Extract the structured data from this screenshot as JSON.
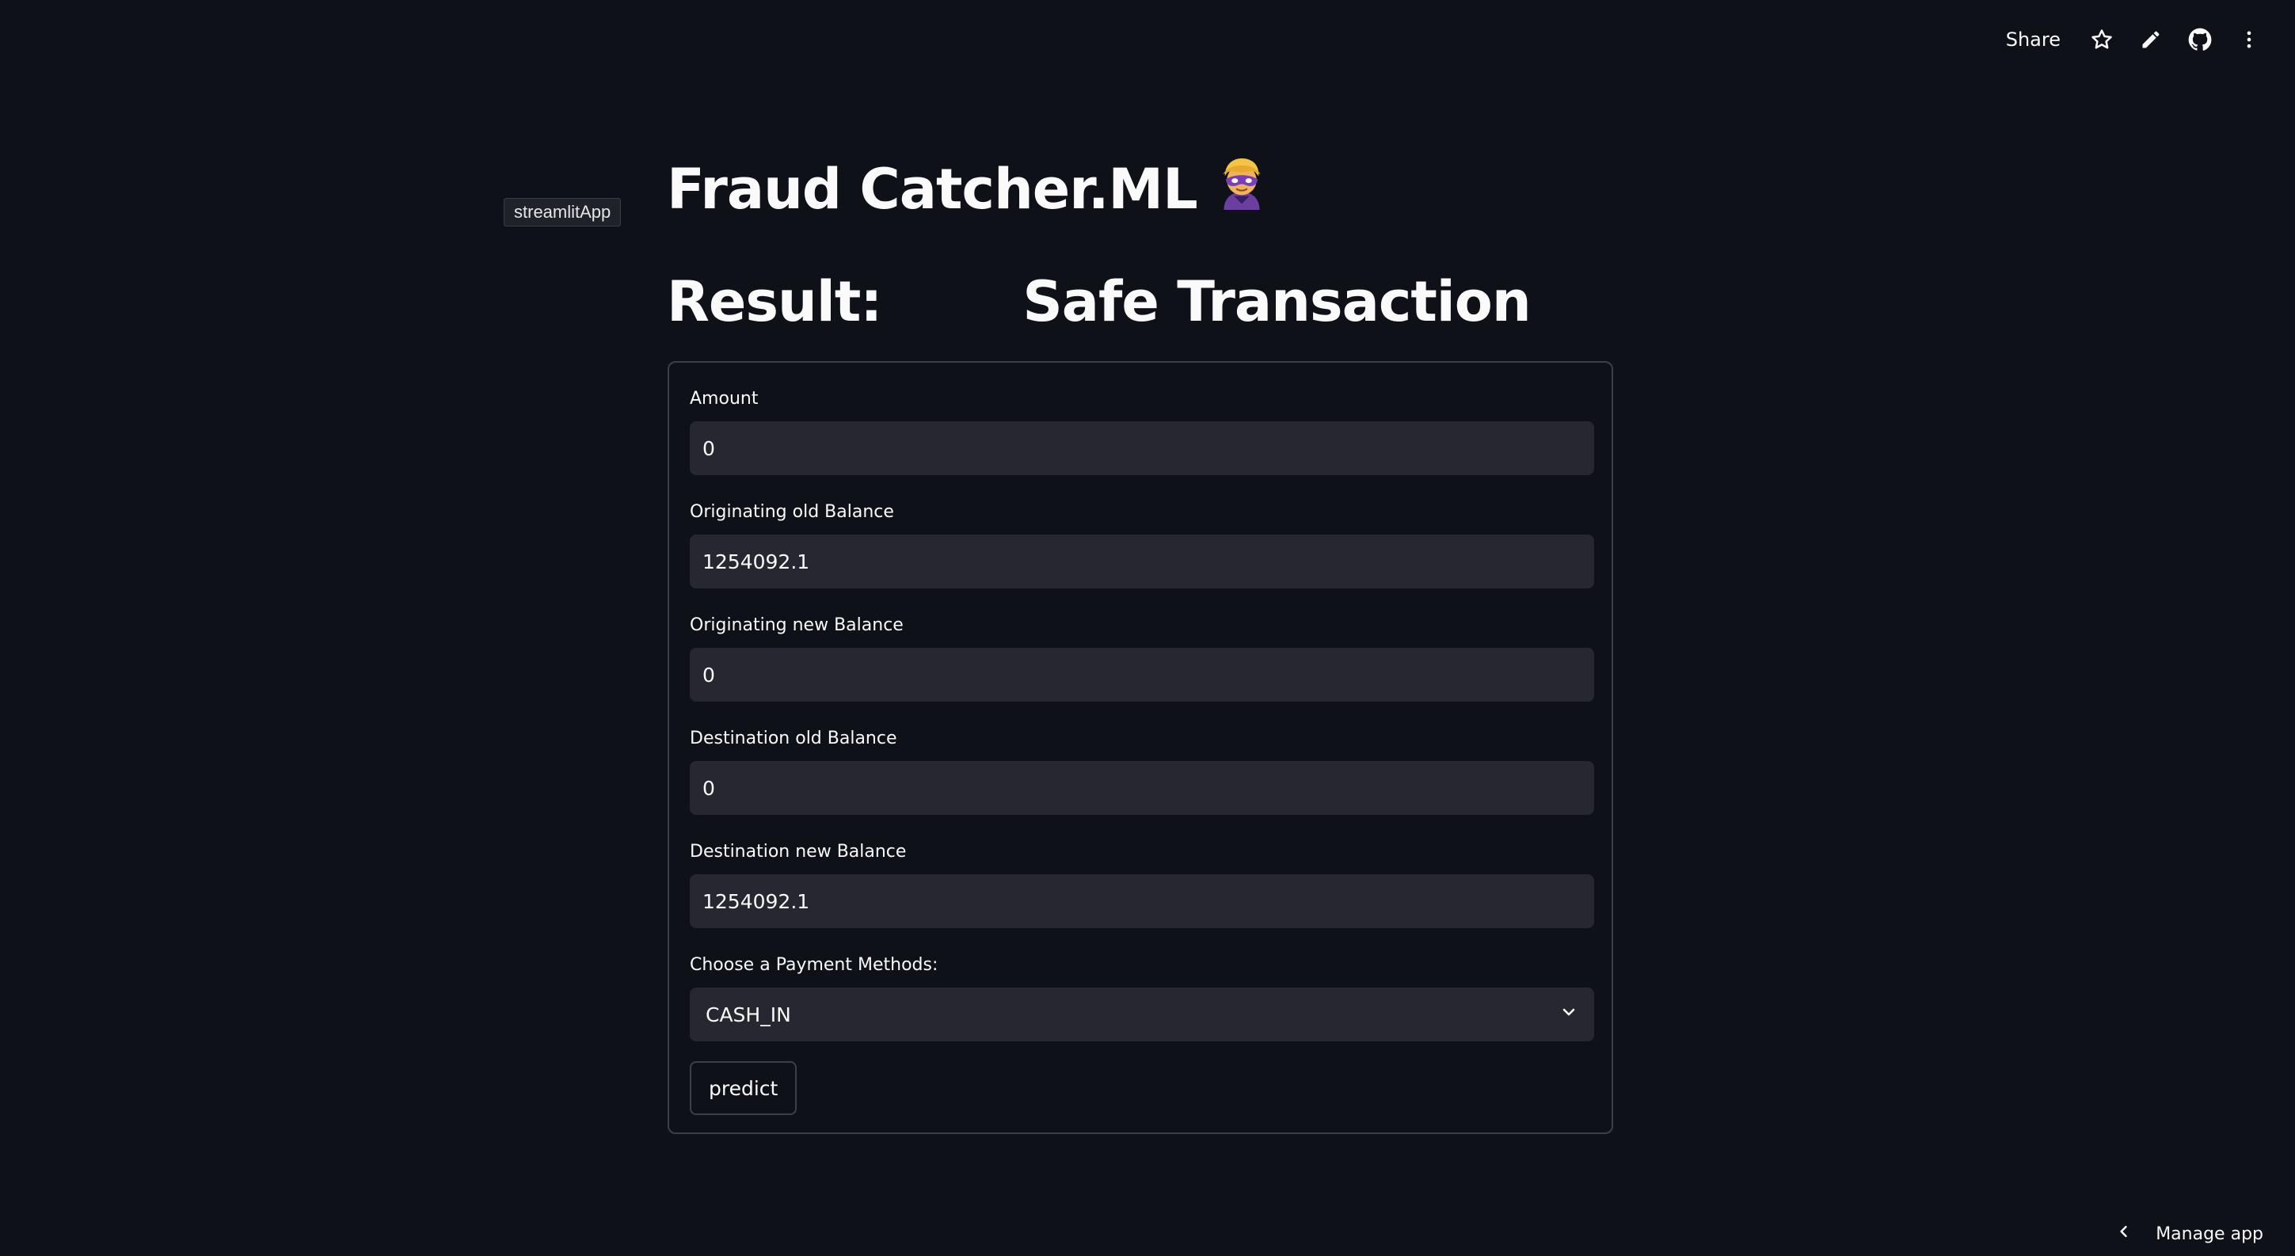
{
  "toolbar": {
    "share_label": "Share",
    "icons": [
      "star-icon",
      "pencil-icon",
      "github-icon",
      "more-vertical-icon"
    ]
  },
  "app_tag": "streamlitApp",
  "title": "Fraud Catcher.ML",
  "title_icon": "masked-hero-emoji",
  "result": {
    "label": "Result:",
    "value": "Safe Transaction"
  },
  "form": {
    "amount": {
      "label": "Amount",
      "value": "0"
    },
    "orig_old_balance": {
      "label": "Originating old Balance",
      "value": "1254092.1"
    },
    "orig_new_balance": {
      "label": "Originating new Balance",
      "value": "0"
    },
    "dest_old_balance": {
      "label": "Destination old Balance",
      "value": "0"
    },
    "dest_new_balance": {
      "label": "Destination new Balance",
      "value": "1254092.1"
    },
    "payment_method": {
      "label": "Choose a Payment Methods:",
      "value": "CASH_IN"
    },
    "predict_label": "predict"
  },
  "manage_app": "Manage app",
  "colors": {
    "background": "#0e1117",
    "input_bg": "#262730",
    "border": "#3b3f47",
    "text": "#fafafa"
  }
}
